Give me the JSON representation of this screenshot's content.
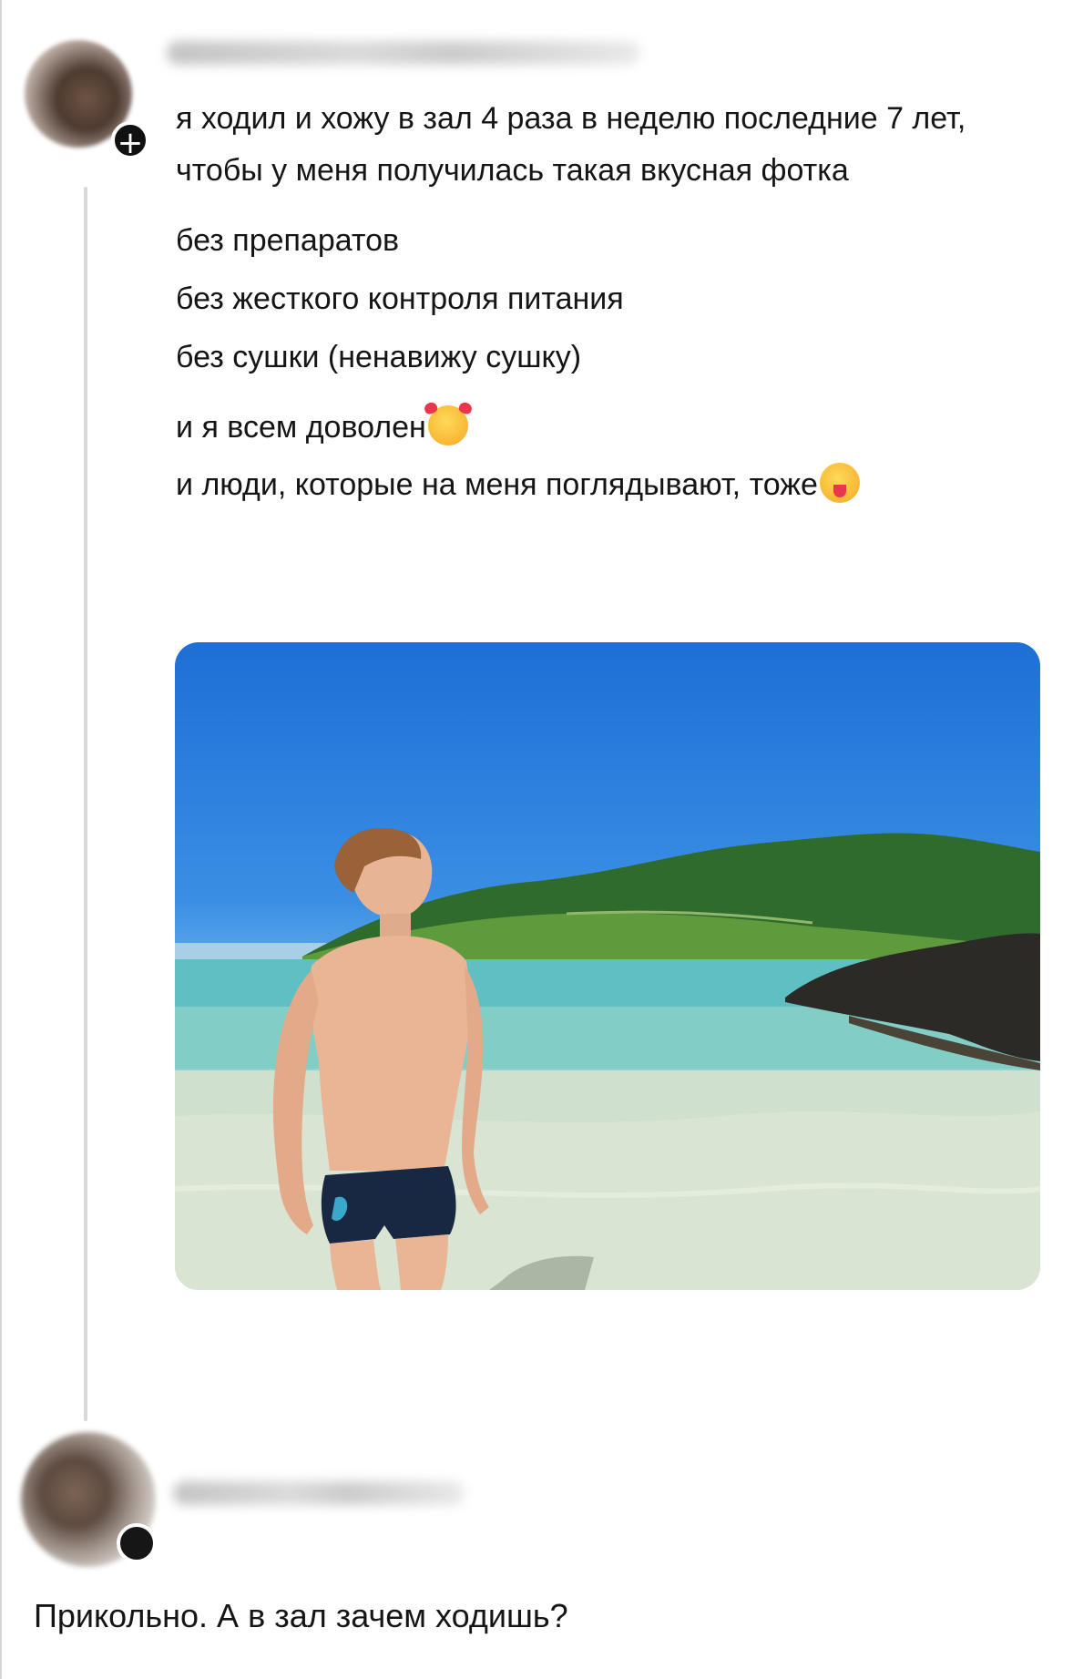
{
  "post": {
    "follow_icon": "plus-icon",
    "lines": [
      "я ходил и хожу в зал 4 раза в неделю последние 7 лет, чтобы у меня получилась такая вкусная фотка",
      "без препаратов",
      "без жесткого контроля питания",
      "без сушки (ненавижу сушку)",
      "и я всем доволен",
      "и люди, которые на меня поглядывают, тоже"
    ],
    "emojis": [
      "smiling-face-with-hearts-emoji",
      "face-with-tongue-emoji"
    ]
  },
  "comment": {
    "text": "Прикольно. А в зал зачем ходишь?"
  }
}
